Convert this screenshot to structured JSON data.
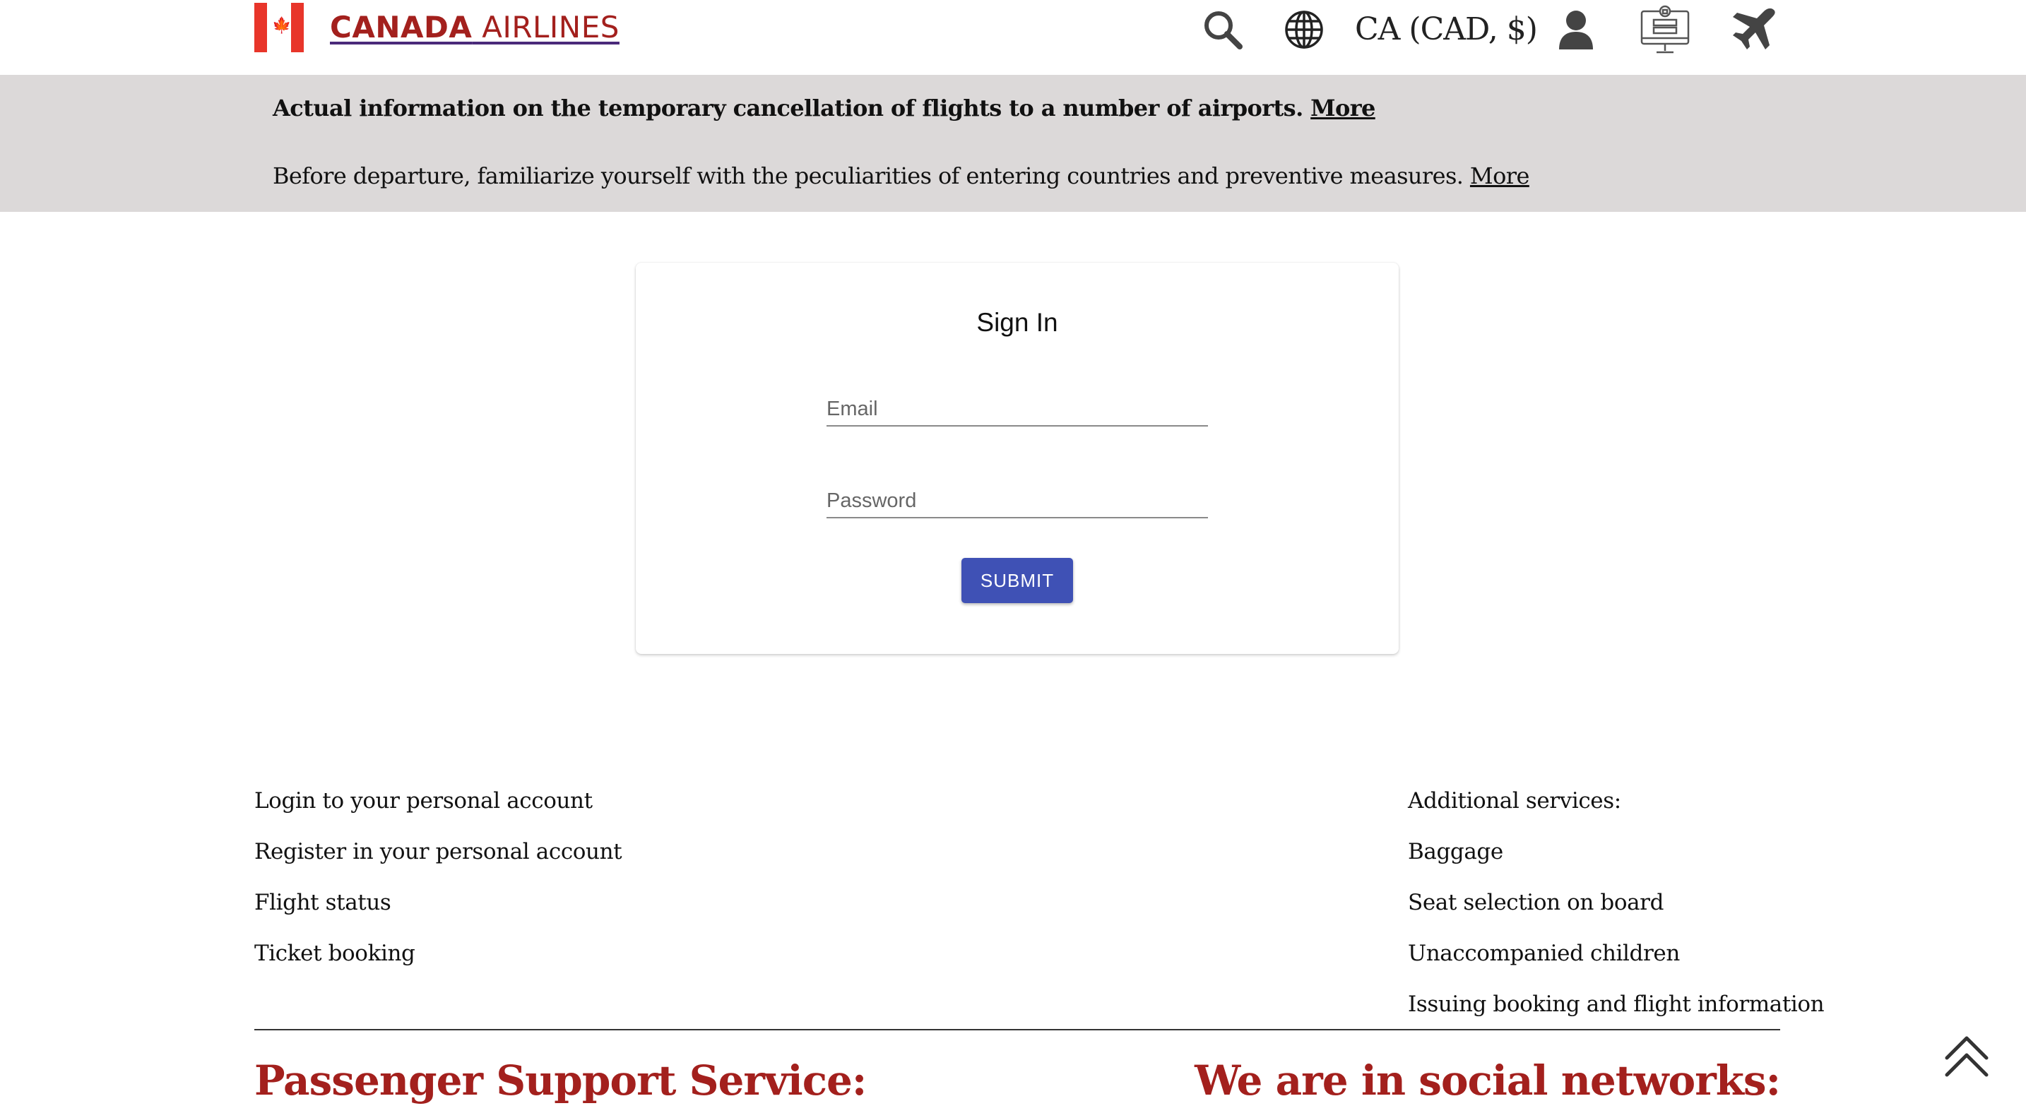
{
  "header": {
    "brand_bold": "CANADA",
    "brand_light": " AIRLINES",
    "flag_leaf": "🍁",
    "currency": "CA (CAD, $)",
    "icons": [
      "search-icon",
      "globe-icon",
      "user-icon",
      "online-checkin-icon",
      "plane-icon"
    ]
  },
  "notices": [
    {
      "text": "Actual information on the temporary cancellation of flights to a number of airports.",
      "link": "More"
    },
    {
      "text": "Before departure, familiarize yourself with the peculiarities of entering countries and preventive measures.",
      "link": "More"
    }
  ],
  "signin": {
    "title": "Sign In",
    "email_placeholder": "Email",
    "password_placeholder": "Password",
    "submit_label": "SUBMIT"
  },
  "footer": {
    "left_links": [
      "Login to your personal account",
      "Register in your personal account",
      "Flight status",
      "Ticket booking"
    ],
    "right_heading": "Additional services:",
    "right_links": [
      "Baggage",
      "Seat selection on board",
      "Unaccompanied children",
      "Issuing booking and flight information"
    ],
    "support_heading": "Passenger Support Service:",
    "social_heading": "We are in social networks:"
  },
  "colors": {
    "brand_red": "#a3201d",
    "flag_red": "#e8352a",
    "banner_bg": "#dcd9d9",
    "submit_blue": "#3f51b5"
  }
}
